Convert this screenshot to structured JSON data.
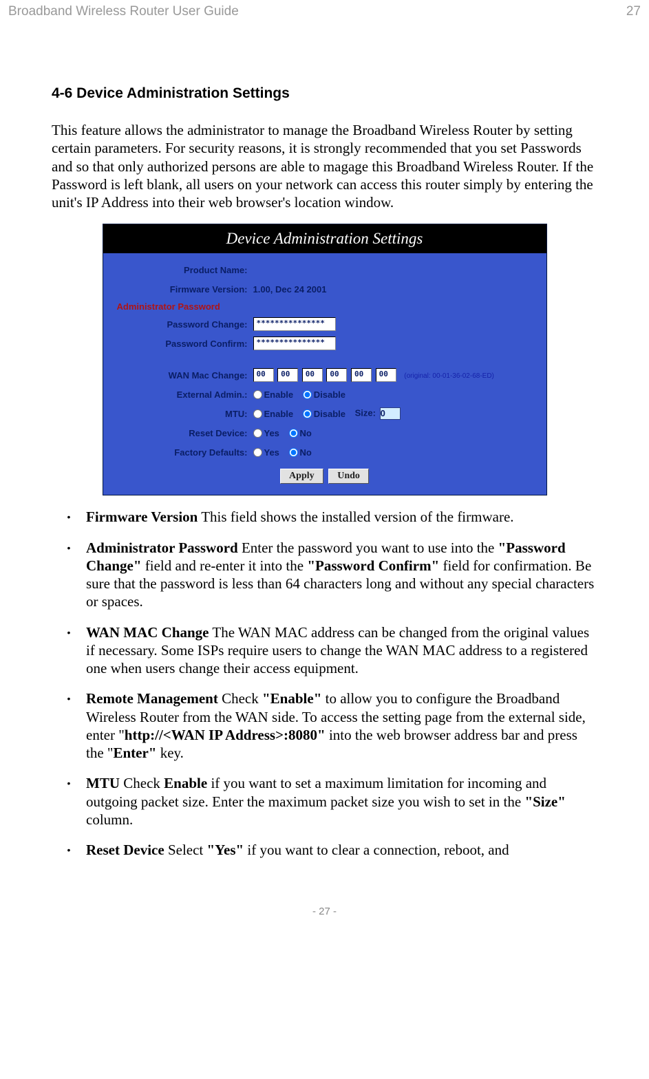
{
  "header": {
    "title": "Broadband Wireless Router User Guide",
    "page_number": "27"
  },
  "section_title": "4-6 Device Administration Settings",
  "intro": "This feature allows the administrator to manage the Broadband Wireless Router by setting certain parameters. For security reasons, it is strongly recommended that you set Passwords and so that only authorized persons are able to magage this Broadband Wireless Router. If the Password is left blank, all users on your network can access this router simply by entering the unit's IP Address into their web browser's location window.",
  "screenshot": {
    "title": "Device Administration Settings",
    "product_name_label": "Product Name:",
    "firmware_label": "Firmware Version:",
    "firmware_value": "1.00, Dec 24 2001",
    "admin_password_header": "Administrator Password",
    "password_change_label": "Password Change:",
    "password_change_value": "***************",
    "password_confirm_label": "Password Confirm:",
    "password_confirm_value": "***************",
    "wan_mac_label": "WAN Mac Change:",
    "wan_mac_values": [
      "00",
      "00",
      "00",
      "00",
      "00",
      "00"
    ],
    "wan_mac_hint": "(original: 00-01-36-02-68-ED)",
    "external_admin_label": "External Admin.:",
    "enable_label": "Enable",
    "disable_label": "Disable",
    "mtu_label": "MTU:",
    "size_label": "Size:",
    "size_value": "0",
    "reset_label": "Reset Device:",
    "yes_label": "Yes",
    "no_label": "No",
    "factory_label": "Factory Defaults:",
    "apply_button": "Apply",
    "undo_button": "Undo"
  },
  "bullets": {
    "firmware_title": "Firmware Version",
    "firmware_text": " This field shows the installed version of the firmware.",
    "admin_title": "Administrator Password",
    "admin_t1": " Enter the password you want to use into the ",
    "admin_b1": "\"Password Change\"",
    "admin_t2": " field and re-enter it into the ",
    "admin_b2": "\"Password Confirm\"",
    "admin_t3": " field for confirmation. Be sure that the password is less than 64 characters long and without any special characters or spaces.",
    "wan_title": "WAN MAC Change",
    "wan_text": " The WAN MAC address can be changed from the original values if necessary. Some ISPs require users to change the WAN MAC address to a registered one when users change their access equipment.",
    "remote_title": "Remote Management",
    "remote_t1": " Check ",
    "remote_b1": "\"Enable\"",
    "remote_t2": " to allow you to configure the Broadband Wireless Router from the WAN side. To access the setting page from the external side, enter \"",
    "remote_b2": "http://<WAN IP Address>:8080\"",
    "remote_t3": " into the web browser address bar and press the \"",
    "remote_b3": "Enter\"",
    "remote_t4": " key.",
    "mtu_title": "MTU",
    "mtu_t1": " Check ",
    "mtu_b1": "Enable",
    "mtu_t2": " if you want to set a maximum limitation for incoming and outgoing packet size. Enter the maximum packet size you wish to set in the ",
    "mtu_b2": "\"Size\"",
    "mtu_t3": " column.",
    "reset_title": "Reset Device",
    "reset_t1": " Select ",
    "reset_b1": "\"Yes\"",
    "reset_t2": " if you want to clear a connection, reboot, and"
  },
  "footer": "- 27 -"
}
